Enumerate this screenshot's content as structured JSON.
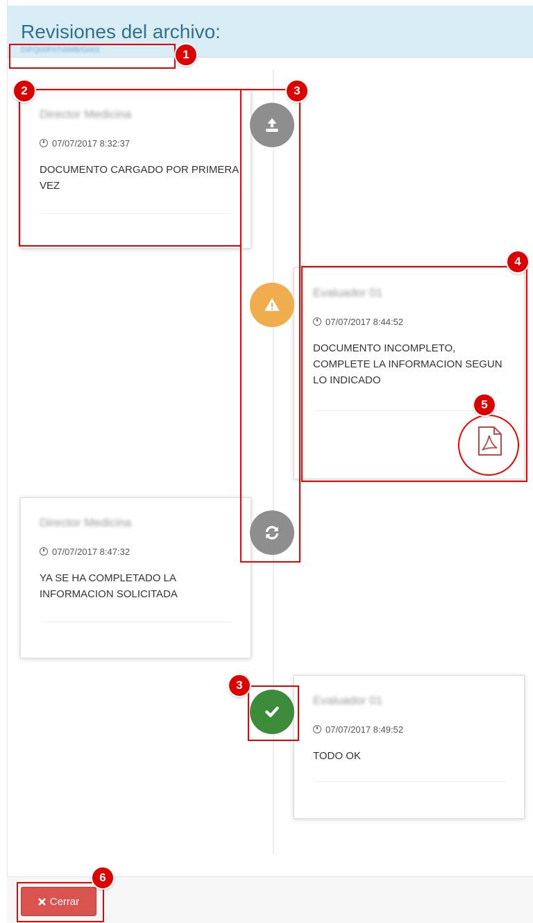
{
  "header": {
    "title": "Revisiones del archivo:",
    "filename": "DIFQ00F07/AMB/G001"
  },
  "timeline": [
    {
      "author": "Director Medicina",
      "date": "07/07/2017 8:32:37",
      "message": "DOCUMENTO CARGADO POR PRIMERA VEZ",
      "status_icon": "upload-icon",
      "status_color": "#8e8e8e"
    },
    {
      "author": "Evaluador 01",
      "date": "07/07/2017 8:44:52",
      "message": "DOCUMENTO INCOMPLETO, COMPLETE LA INFORMACION SEGUN LO INDICADO",
      "status_icon": "warning-icon",
      "status_color": "#f0ad4e",
      "attachment_icon": "pdf-icon"
    },
    {
      "author": "Director Medicina",
      "date": "07/07/2017 8:47:32",
      "message": "YA SE HA COMPLETADO LA INFORMACION SOLICITADA",
      "status_icon": "refresh-icon",
      "status_color": "#8e8e8e"
    },
    {
      "author": "Evaluador 01",
      "date": "07/07/2017 8:49:52",
      "message": "TODO OK",
      "status_icon": "check-icon",
      "status_color": "#3c8c3c"
    }
  ],
  "annotations": [
    "1",
    "2",
    "3",
    "4",
    "5",
    "3",
    "6"
  ],
  "footer": {
    "close_label": "Cerrar",
    "close_icon": "close-icon",
    "close_color": "#d9534f"
  }
}
